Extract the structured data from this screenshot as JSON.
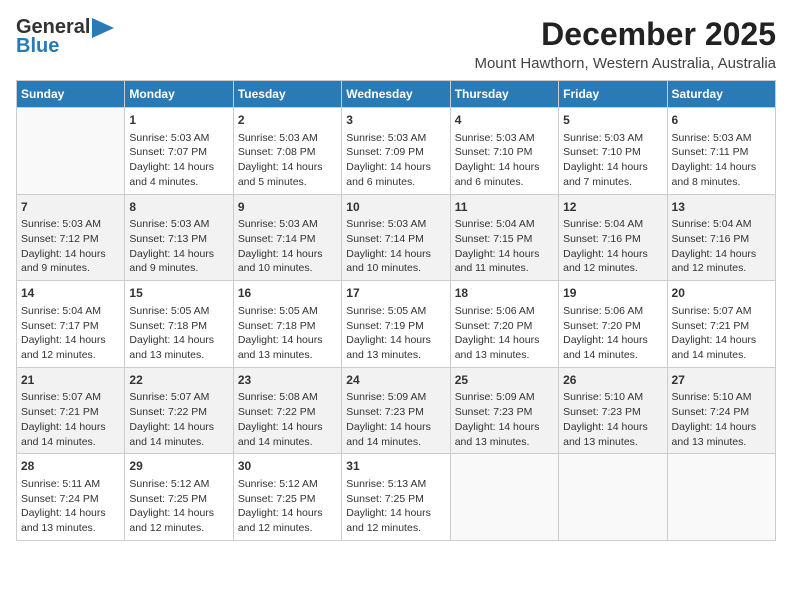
{
  "header": {
    "logo_line1": "General",
    "logo_line2": "Blue",
    "month": "December 2025",
    "location": "Mount Hawthorn, Western Australia, Australia"
  },
  "weekdays": [
    "Sunday",
    "Monday",
    "Tuesday",
    "Wednesday",
    "Thursday",
    "Friday",
    "Saturday"
  ],
  "weeks": [
    [
      {
        "day": "",
        "sunrise": "",
        "sunset": "",
        "daylight": ""
      },
      {
        "day": "1",
        "sunrise": "Sunrise: 5:03 AM",
        "sunset": "Sunset: 7:07 PM",
        "daylight": "Daylight: 14 hours and 4 minutes."
      },
      {
        "day": "2",
        "sunrise": "Sunrise: 5:03 AM",
        "sunset": "Sunset: 7:08 PM",
        "daylight": "Daylight: 14 hours and 5 minutes."
      },
      {
        "day": "3",
        "sunrise": "Sunrise: 5:03 AM",
        "sunset": "Sunset: 7:09 PM",
        "daylight": "Daylight: 14 hours and 6 minutes."
      },
      {
        "day": "4",
        "sunrise": "Sunrise: 5:03 AM",
        "sunset": "Sunset: 7:10 PM",
        "daylight": "Daylight: 14 hours and 6 minutes."
      },
      {
        "day": "5",
        "sunrise": "Sunrise: 5:03 AM",
        "sunset": "Sunset: 7:10 PM",
        "daylight": "Daylight: 14 hours and 7 minutes."
      },
      {
        "day": "6",
        "sunrise": "Sunrise: 5:03 AM",
        "sunset": "Sunset: 7:11 PM",
        "daylight": "Daylight: 14 hours and 8 minutes."
      }
    ],
    [
      {
        "day": "7",
        "sunrise": "Sunrise: 5:03 AM",
        "sunset": "Sunset: 7:12 PM",
        "daylight": "Daylight: 14 hours and 9 minutes."
      },
      {
        "day": "8",
        "sunrise": "Sunrise: 5:03 AM",
        "sunset": "Sunset: 7:13 PM",
        "daylight": "Daylight: 14 hours and 9 minutes."
      },
      {
        "day": "9",
        "sunrise": "Sunrise: 5:03 AM",
        "sunset": "Sunset: 7:14 PM",
        "daylight": "Daylight: 14 hours and 10 minutes."
      },
      {
        "day": "10",
        "sunrise": "Sunrise: 5:03 AM",
        "sunset": "Sunset: 7:14 PM",
        "daylight": "Daylight: 14 hours and 10 minutes."
      },
      {
        "day": "11",
        "sunrise": "Sunrise: 5:04 AM",
        "sunset": "Sunset: 7:15 PM",
        "daylight": "Daylight: 14 hours and 11 minutes."
      },
      {
        "day": "12",
        "sunrise": "Sunrise: 5:04 AM",
        "sunset": "Sunset: 7:16 PM",
        "daylight": "Daylight: 14 hours and 12 minutes."
      },
      {
        "day": "13",
        "sunrise": "Sunrise: 5:04 AM",
        "sunset": "Sunset: 7:16 PM",
        "daylight": "Daylight: 14 hours and 12 minutes."
      }
    ],
    [
      {
        "day": "14",
        "sunrise": "Sunrise: 5:04 AM",
        "sunset": "Sunset: 7:17 PM",
        "daylight": "Daylight: 14 hours and 12 minutes."
      },
      {
        "day": "15",
        "sunrise": "Sunrise: 5:05 AM",
        "sunset": "Sunset: 7:18 PM",
        "daylight": "Daylight: 14 hours and 13 minutes."
      },
      {
        "day": "16",
        "sunrise": "Sunrise: 5:05 AM",
        "sunset": "Sunset: 7:18 PM",
        "daylight": "Daylight: 14 hours and 13 minutes."
      },
      {
        "day": "17",
        "sunrise": "Sunrise: 5:05 AM",
        "sunset": "Sunset: 7:19 PM",
        "daylight": "Daylight: 14 hours and 13 minutes."
      },
      {
        "day": "18",
        "sunrise": "Sunrise: 5:06 AM",
        "sunset": "Sunset: 7:20 PM",
        "daylight": "Daylight: 14 hours and 13 minutes."
      },
      {
        "day": "19",
        "sunrise": "Sunrise: 5:06 AM",
        "sunset": "Sunset: 7:20 PM",
        "daylight": "Daylight: 14 hours and 14 minutes."
      },
      {
        "day": "20",
        "sunrise": "Sunrise: 5:07 AM",
        "sunset": "Sunset: 7:21 PM",
        "daylight": "Daylight: 14 hours and 14 minutes."
      }
    ],
    [
      {
        "day": "21",
        "sunrise": "Sunrise: 5:07 AM",
        "sunset": "Sunset: 7:21 PM",
        "daylight": "Daylight: 14 hours and 14 minutes."
      },
      {
        "day": "22",
        "sunrise": "Sunrise: 5:07 AM",
        "sunset": "Sunset: 7:22 PM",
        "daylight": "Daylight: 14 hours and 14 minutes."
      },
      {
        "day": "23",
        "sunrise": "Sunrise: 5:08 AM",
        "sunset": "Sunset: 7:22 PM",
        "daylight": "Daylight: 14 hours and 14 minutes."
      },
      {
        "day": "24",
        "sunrise": "Sunrise: 5:09 AM",
        "sunset": "Sunset: 7:23 PM",
        "daylight": "Daylight: 14 hours and 14 minutes."
      },
      {
        "day": "25",
        "sunrise": "Sunrise: 5:09 AM",
        "sunset": "Sunset: 7:23 PM",
        "daylight": "Daylight: 14 hours and 13 minutes."
      },
      {
        "day": "26",
        "sunrise": "Sunrise: 5:10 AM",
        "sunset": "Sunset: 7:23 PM",
        "daylight": "Daylight: 14 hours and 13 minutes."
      },
      {
        "day": "27",
        "sunrise": "Sunrise: 5:10 AM",
        "sunset": "Sunset: 7:24 PM",
        "daylight": "Daylight: 14 hours and 13 minutes."
      }
    ],
    [
      {
        "day": "28",
        "sunrise": "Sunrise: 5:11 AM",
        "sunset": "Sunset: 7:24 PM",
        "daylight": "Daylight: 14 hours and 13 minutes."
      },
      {
        "day": "29",
        "sunrise": "Sunrise: 5:12 AM",
        "sunset": "Sunset: 7:25 PM",
        "daylight": "Daylight: 14 hours and 12 minutes."
      },
      {
        "day": "30",
        "sunrise": "Sunrise: 5:12 AM",
        "sunset": "Sunset: 7:25 PM",
        "daylight": "Daylight: 14 hours and 12 minutes."
      },
      {
        "day": "31",
        "sunrise": "Sunrise: 5:13 AM",
        "sunset": "Sunset: 7:25 PM",
        "daylight": "Daylight: 14 hours and 12 minutes."
      },
      {
        "day": "",
        "sunrise": "",
        "sunset": "",
        "daylight": ""
      },
      {
        "day": "",
        "sunrise": "",
        "sunset": "",
        "daylight": ""
      },
      {
        "day": "",
        "sunrise": "",
        "sunset": "",
        "daylight": ""
      }
    ]
  ]
}
